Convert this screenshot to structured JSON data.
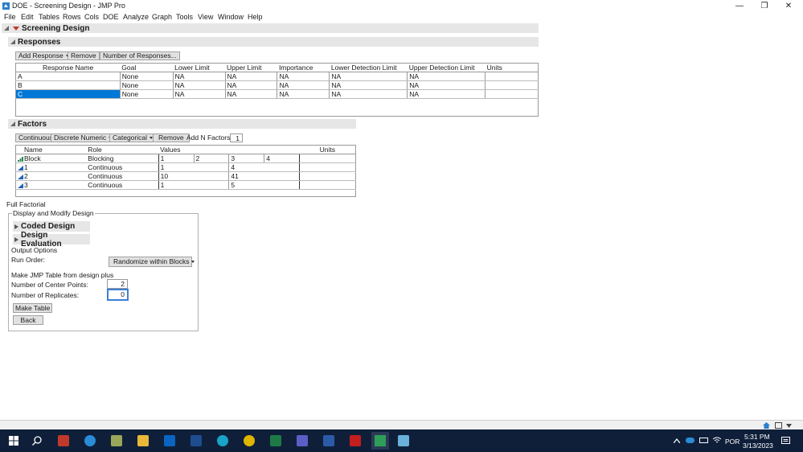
{
  "window": {
    "title": "DOE - Screening Design - JMP Pro",
    "minimize": "—",
    "maximize": "❐",
    "close": "✕"
  },
  "menu": [
    "File",
    "Edit",
    "Tables",
    "Rows",
    "Cols",
    "DOE",
    "Analyze",
    "Graph",
    "Tools",
    "View",
    "Window",
    "Help"
  ],
  "design_title": "Screening Design",
  "responses": {
    "title": "Responses",
    "add_response": "Add Response",
    "remove": "Remove",
    "number_of_responses": "Number of Responses...",
    "columns": [
      "Response Name",
      "Goal",
      "Lower Limit",
      "Upper Limit",
      "Importance",
      "Lower Detection Limit",
      "Upper Detection Limit",
      "Units"
    ],
    "rows": [
      {
        "name": "A",
        "goal": "None",
        "lower": "NA",
        "upper": "NA",
        "importance": "NA",
        "ldl": "NA",
        "udl": "NA",
        "units": ""
      },
      {
        "name": "B",
        "goal": "None",
        "lower": "NA",
        "upper": "NA",
        "importance": "NA",
        "ldl": "NA",
        "udl": "NA",
        "units": ""
      },
      {
        "name": "C",
        "goal": "None",
        "lower": "NA",
        "upper": "NA",
        "importance": "NA",
        "ldl": "NA",
        "udl": "NA",
        "units": ""
      }
    ]
  },
  "factors": {
    "title": "Factors",
    "continuous": "Continuous",
    "discrete_numeric": "Discrete Numeric",
    "categorical": "Categorical",
    "remove": "Remove",
    "add_n_factors": "Add N Factors",
    "add_n_value": "1",
    "columns": [
      "Name",
      "Role",
      "Values",
      "Units"
    ],
    "rows": [
      {
        "name": "Block",
        "role": "Blocking",
        "values": [
          "1",
          "2",
          "3",
          "4"
        ],
        "units": ""
      },
      {
        "name": "1",
        "role": "Continuous",
        "values": [
          "1",
          "4"
        ],
        "units": ""
      },
      {
        "name": "2",
        "role": "Continuous",
        "values": [
          "10",
          "41"
        ],
        "units": ""
      },
      {
        "name": "3",
        "role": "Continuous",
        "values": [
          "1",
          "5"
        ],
        "units": ""
      }
    ]
  },
  "design": {
    "type_label": "Full Factorial",
    "group_title": "Display and Modify Design",
    "coded_design": "Coded Design",
    "design_evaluation": "Design Evaluation",
    "output_options": "Output Options",
    "run_order_label": "Run Order:",
    "run_order_value": "Randomize within Blocks",
    "make_table_label": "Make JMP Table from design plus",
    "center_points_label": "Number of Center Points:",
    "center_points_value": "2",
    "replicates_label": "Number of Replicates:",
    "replicates_value": "0",
    "make_table_button": "Make Table",
    "back_button": "Back"
  },
  "taskbar": {
    "language": "POR",
    "time": "5:31 PM",
    "date": "3/13/2023"
  },
  "colors": {
    "selection": "#0078d7",
    "taskbar": "#0f1f3a",
    "header_bg": "#e6e6e6"
  }
}
